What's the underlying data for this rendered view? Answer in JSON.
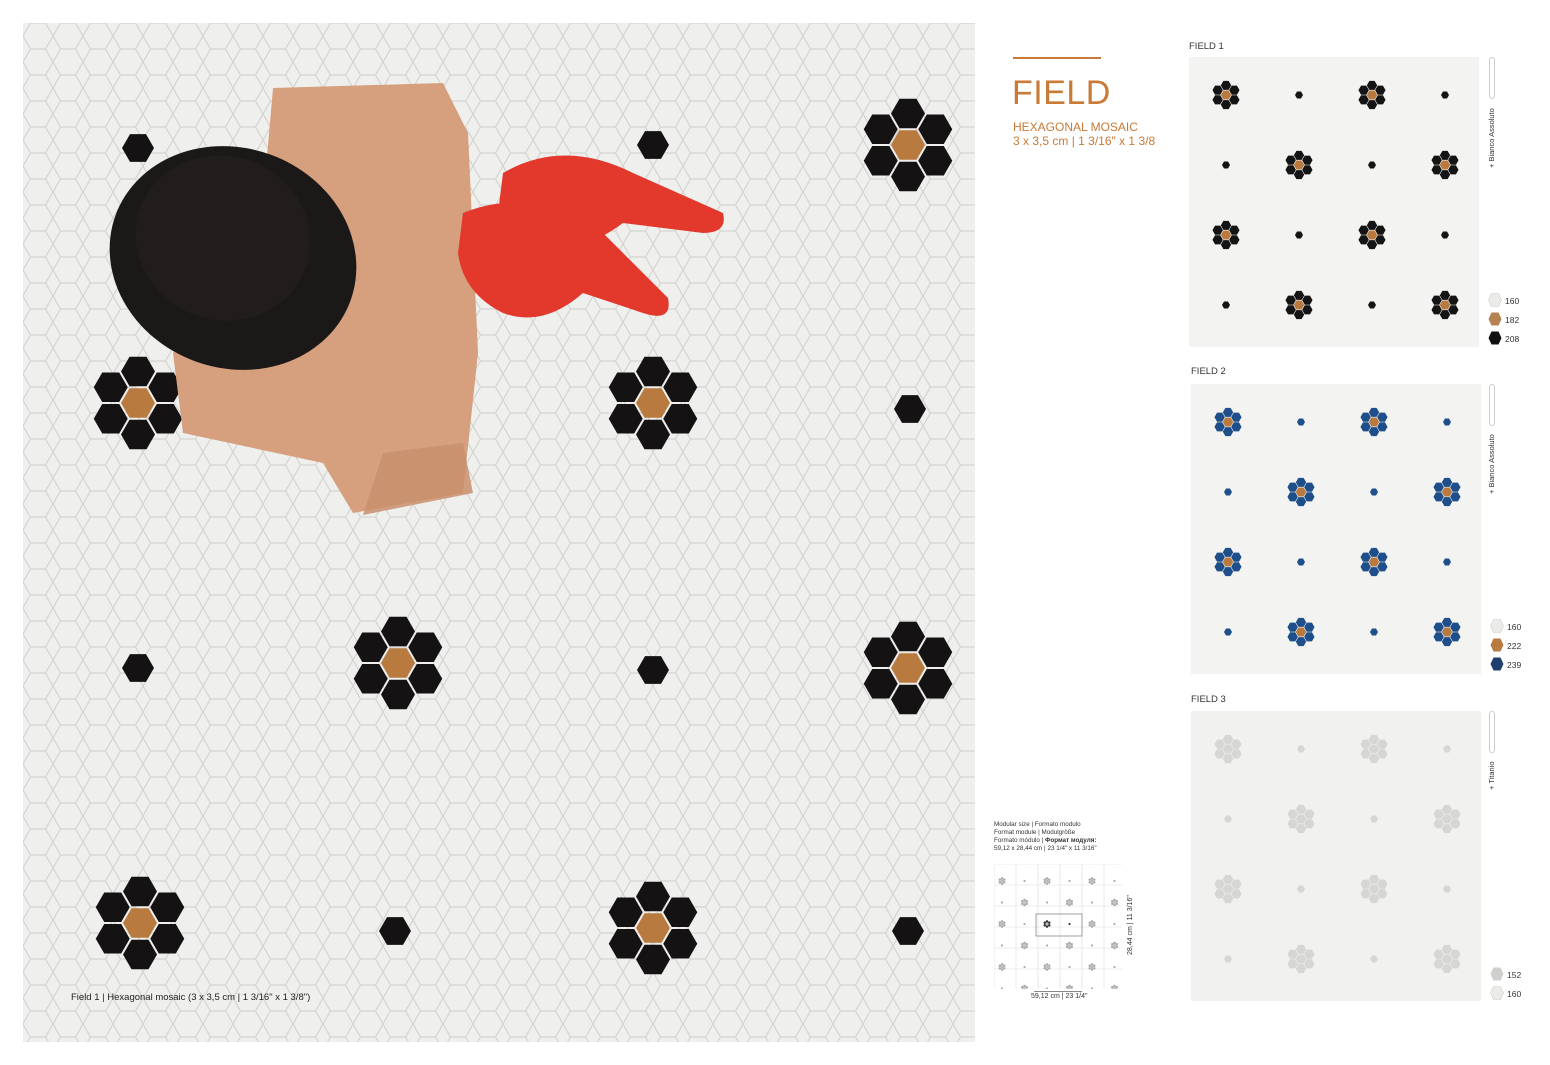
{
  "photo": {
    "caption": "Field 1 | Hexagonal mosaic (3 x 3,5 cm | 1 3/16\" x 1 3/8\")",
    "colors": {
      "floor": "#efefed",
      "black": "#141212",
      "brown": "#b97a40",
      "hat": "#1b1818",
      "cloth": "#d6a07e",
      "shoe": "#e2392c"
    }
  },
  "header": {
    "title": "FIELD",
    "subtitle_1": "HEXAGONAL MOSAIC",
    "subtitle_2": "3 x 3,5 cm | 1 3/16\" x 1 3/8",
    "accent_color": "#c97a37"
  },
  "module": {
    "line_1": "Modular size | Formato modulo",
    "line_2": "Format module | Modulgröße",
    "line_3_plain": "Formato módulo | ",
    "line_3_bold": "Формат модуля:",
    "line_4": "59,12 x 28,44 cm | 23 1/4\" x 11 3/16\"",
    "width_label": "59,12 cm | 23 1/4\"",
    "height_label": "28,44 cm | 11 3/16\""
  },
  "fields": [
    {
      "label": "FIELD 1",
      "side_label": "+ Bianco Assoluto",
      "dot_color": "#141414",
      "center_color": "#b97a40",
      "swatches": [
        {
          "code": "160",
          "color": "#ebebe8"
        },
        {
          "code": "182",
          "color": "#b48250"
        },
        {
          "code": "208",
          "color": "#111111"
        }
      ]
    },
    {
      "label": "FIELD 2",
      "side_label": "+ Bianco Assoluto",
      "dot_color": "#1e4f8a",
      "center_color": "#b97a40",
      "swatches": [
        {
          "code": "160",
          "color": "#ebebe8"
        },
        {
          "code": "222",
          "color": "#b97a40"
        },
        {
          "code": "239",
          "color": "#1e3f6e"
        }
      ]
    },
    {
      "label": "FIELD 3",
      "side_label": "+ Titanio",
      "dot_color": "#d6d6d4",
      "center_color": "#d6d6d4",
      "swatches": [
        {
          "code": "152",
          "color": "#cfcfcd"
        },
        {
          "code": "160",
          "color": "#ebebe8"
        }
      ]
    }
  ]
}
